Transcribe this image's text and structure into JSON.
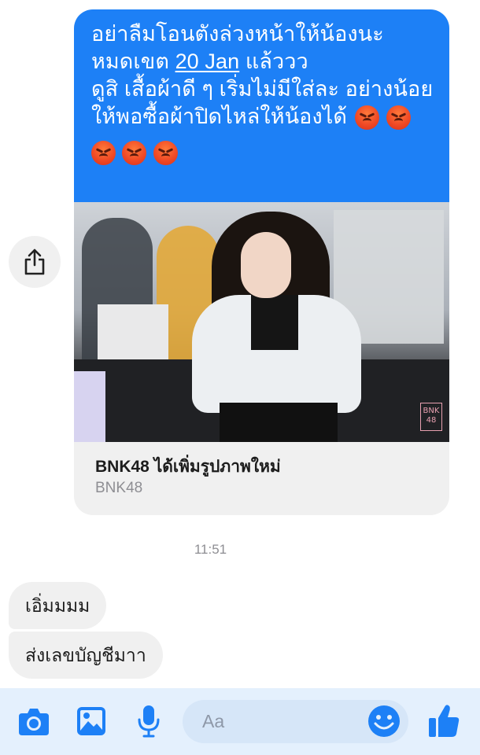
{
  "outgoing_message": {
    "line1": "อย่าลืมโอนตังล่วงหน้าให้น้องนะ",
    "line2_prefix": "หมดเขต",
    "line2_date": "20 Jan",
    "line2_suffix": "แล้ววว",
    "line3": "ดูสิ เสื้อผ้าดี ๆ เริ่มไม่มีใส่ละ อย่างน้อย",
    "line4": "ให้พอซื้อผ้าปิดไหล่ให้น้องได้",
    "emoji": "angry-face-icon",
    "emoji_count_line4": 2,
    "emoji_count_line5": 3,
    "bubble_color": "#1d80f6"
  },
  "link_preview": {
    "title": "BNK48 ได้เพิ่มรูปภาพใหม่",
    "source": "BNK48",
    "photo_logo": "BNK 48"
  },
  "timestamp": "11:51",
  "incoming_messages": [
    {
      "text": "เอิ่มมมม"
    },
    {
      "text": "ส่งเลขบัญชีมาา"
    }
  ],
  "composer": {
    "placeholder": "Aa",
    "icons": [
      "camera-icon",
      "gallery-icon",
      "microphone-icon",
      "emoji-icon",
      "thumbs-up-icon"
    ],
    "accent": "#1d80f6"
  }
}
